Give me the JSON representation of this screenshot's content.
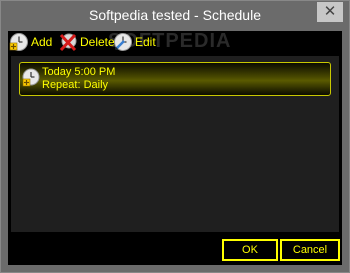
{
  "window": {
    "title": "Softpedia tested - Schedule",
    "close_glyph": "✕"
  },
  "toolbar": {
    "add_label": "Add",
    "delete_label": "Delete",
    "edit_label": "Edit"
  },
  "watermark": "SOFTPEDIA",
  "schedule": {
    "items": [
      {
        "line1": "Today 5:00 PM",
        "line2": "Repeat: Daily"
      }
    ]
  },
  "buttons": {
    "ok": "OK",
    "cancel": "Cancel"
  },
  "colors": {
    "accent": "#ffff00",
    "background": "#000000",
    "titlebar": "#6b6b6b",
    "panel": "#1f1f1f"
  },
  "icons": {
    "add": "clock-plus-icon",
    "delete": "red-x-icon",
    "edit": "clock-pencil-icon",
    "item": "clock-plus-icon"
  }
}
